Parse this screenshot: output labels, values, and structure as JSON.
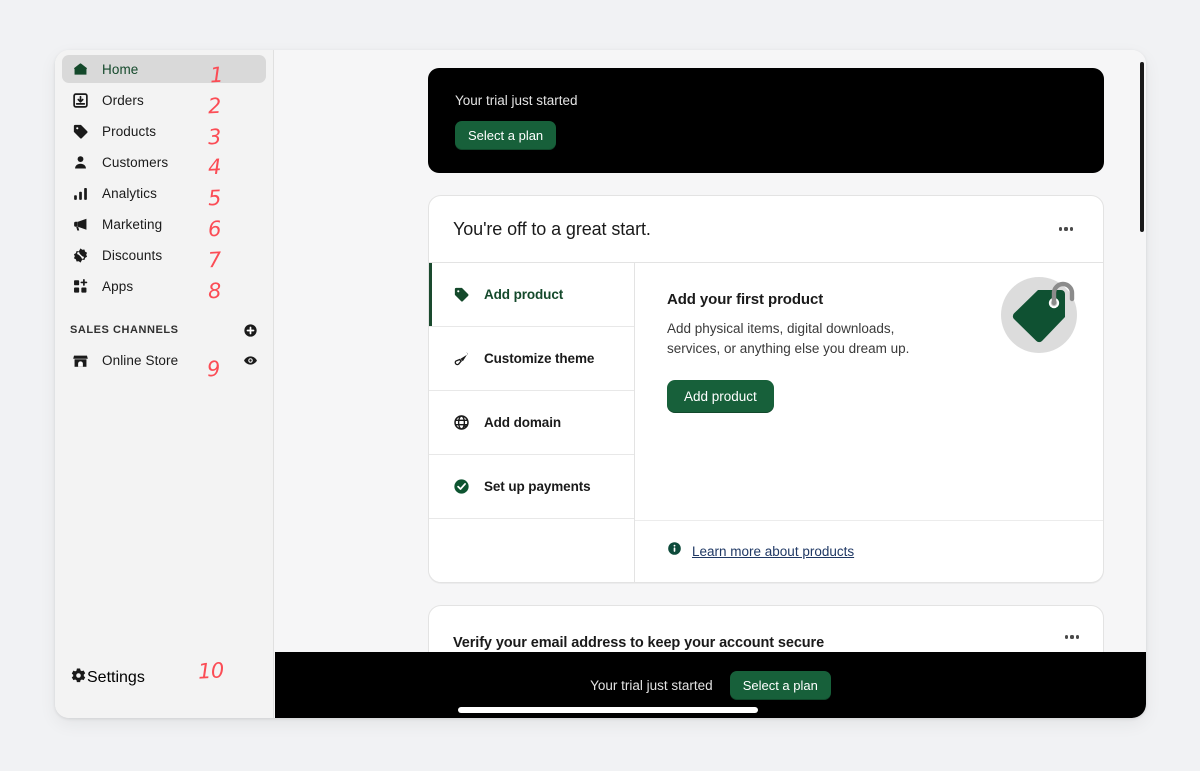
{
  "sidebar": {
    "nav_items": [
      {
        "label": "Home",
        "icon": "home-icon",
        "active": true,
        "anno": "1"
      },
      {
        "label": "Orders",
        "icon": "orders-icon",
        "active": false,
        "anno": "2"
      },
      {
        "label": "Products",
        "icon": "products-icon",
        "active": false,
        "anno": "3"
      },
      {
        "label": "Customers",
        "icon": "customers-icon",
        "active": false,
        "anno": "4"
      },
      {
        "label": "Analytics",
        "icon": "analytics-icon",
        "active": false,
        "anno": "5"
      },
      {
        "label": "Marketing",
        "icon": "marketing-icon",
        "active": false,
        "anno": "6"
      },
      {
        "label": "Discounts",
        "icon": "discounts-icon",
        "active": false,
        "anno": "7"
      },
      {
        "label": "Apps",
        "icon": "apps-icon",
        "active": false,
        "anno": "8"
      }
    ],
    "sales_channels": {
      "title": "SALES CHANNELS",
      "add_icon": "plus-circle-icon",
      "items": [
        {
          "label": "Online Store",
          "icon": "storefront-icon",
          "eye_icon": "eye-icon",
          "anno": "9"
        }
      ]
    },
    "settings": {
      "label": "Settings",
      "icon": "gear-icon",
      "anno": "10"
    }
  },
  "trial_banner": {
    "message": "Your trial just started",
    "cta_label": "Select a plan"
  },
  "setup_guide": {
    "title": "You're off to a great start.",
    "menu_icon": "kebab-menu-icon",
    "steps": [
      {
        "label": "Add product",
        "icon": "tag-icon",
        "active": true
      },
      {
        "label": "Customize theme",
        "icon": "paintbrush-icon",
        "active": false
      },
      {
        "label": "Add domain",
        "icon": "globe-icon",
        "active": false
      },
      {
        "label": "Set up payments",
        "icon": "check-circle-icon",
        "active": false
      }
    ],
    "detail": {
      "title": "Add your first product",
      "description": "Add physical items, digital downloads, services, or anything else you dream up.",
      "cta_label": "Add product",
      "illustration": "product-tag-illustration",
      "learn_more_icon": "info-icon",
      "learn_more_label": "Learn more about products"
    }
  },
  "verify_card": {
    "title": "Verify your email address to keep your account secure",
    "menu_icon": "kebab-menu-icon"
  },
  "bottom_bar": {
    "message": "Your trial just started",
    "cta_label": "Select a plan"
  },
  "colors": {
    "brand_green": "#17603a",
    "dark_green": "#14492b",
    "annotation_red": "#fb4c55",
    "banner_black": "#000000",
    "link_blue": "#1f3864",
    "page_bg": "#f1f2f4"
  }
}
